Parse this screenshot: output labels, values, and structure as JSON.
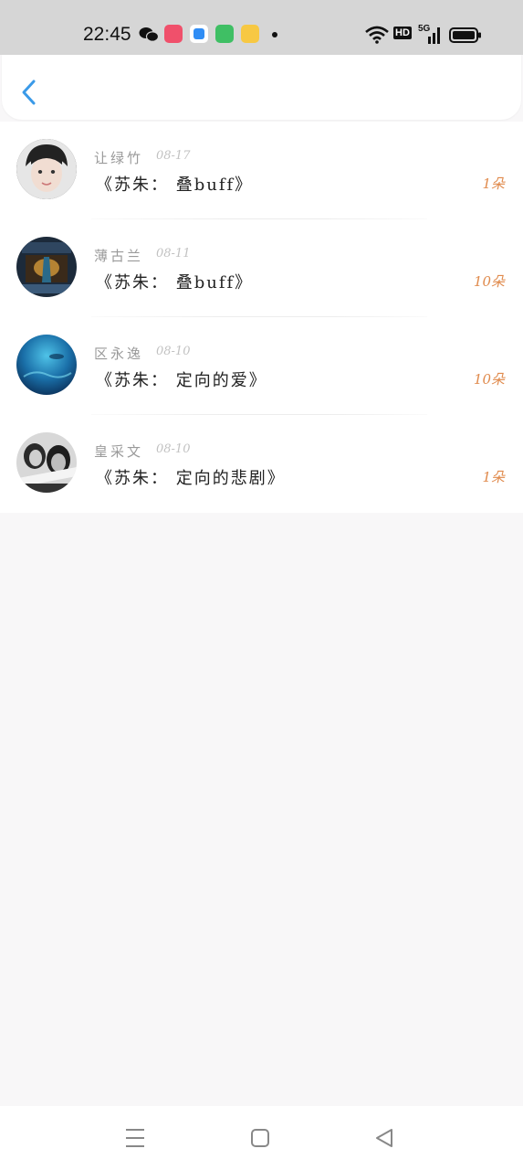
{
  "status_bar": {
    "time": "22:45",
    "network_label": "HD",
    "signal_label": "5G",
    "icons": [
      "wechat-icon",
      "app-icon-red",
      "app-icon-blue",
      "app-icon-green",
      "app-icon-yellow",
      "notification-dot",
      "wifi-icon",
      "hd-icon",
      "signal-5g-icon",
      "battery-icon"
    ]
  },
  "header": {
    "back_icon": "chevron-left-icon",
    "accent_color": "#3a9ae8"
  },
  "list": {
    "items": [
      {
        "name": "让绿竹",
        "date": "08-17",
        "title": "《苏朱：  叠buff》",
        "count": "1朵"
      },
      {
        "name": "薄古兰",
        "date": "08-11",
        "title": "《苏朱：  叠buff》",
        "count": "10朵"
      },
      {
        "name": "区永逸",
        "date": "08-10",
        "title": "《苏朱：  定向的爱》",
        "count": "10朵"
      },
      {
        "name": "皇采文",
        "date": "08-10",
        "title": "《苏朱：  定向的悲剧》",
        "count": "1朵"
      }
    ],
    "count_color": "#e08a4c"
  },
  "nav_bar": {
    "icons": [
      "menu-icon",
      "home-square-icon",
      "back-triangle-icon"
    ]
  }
}
